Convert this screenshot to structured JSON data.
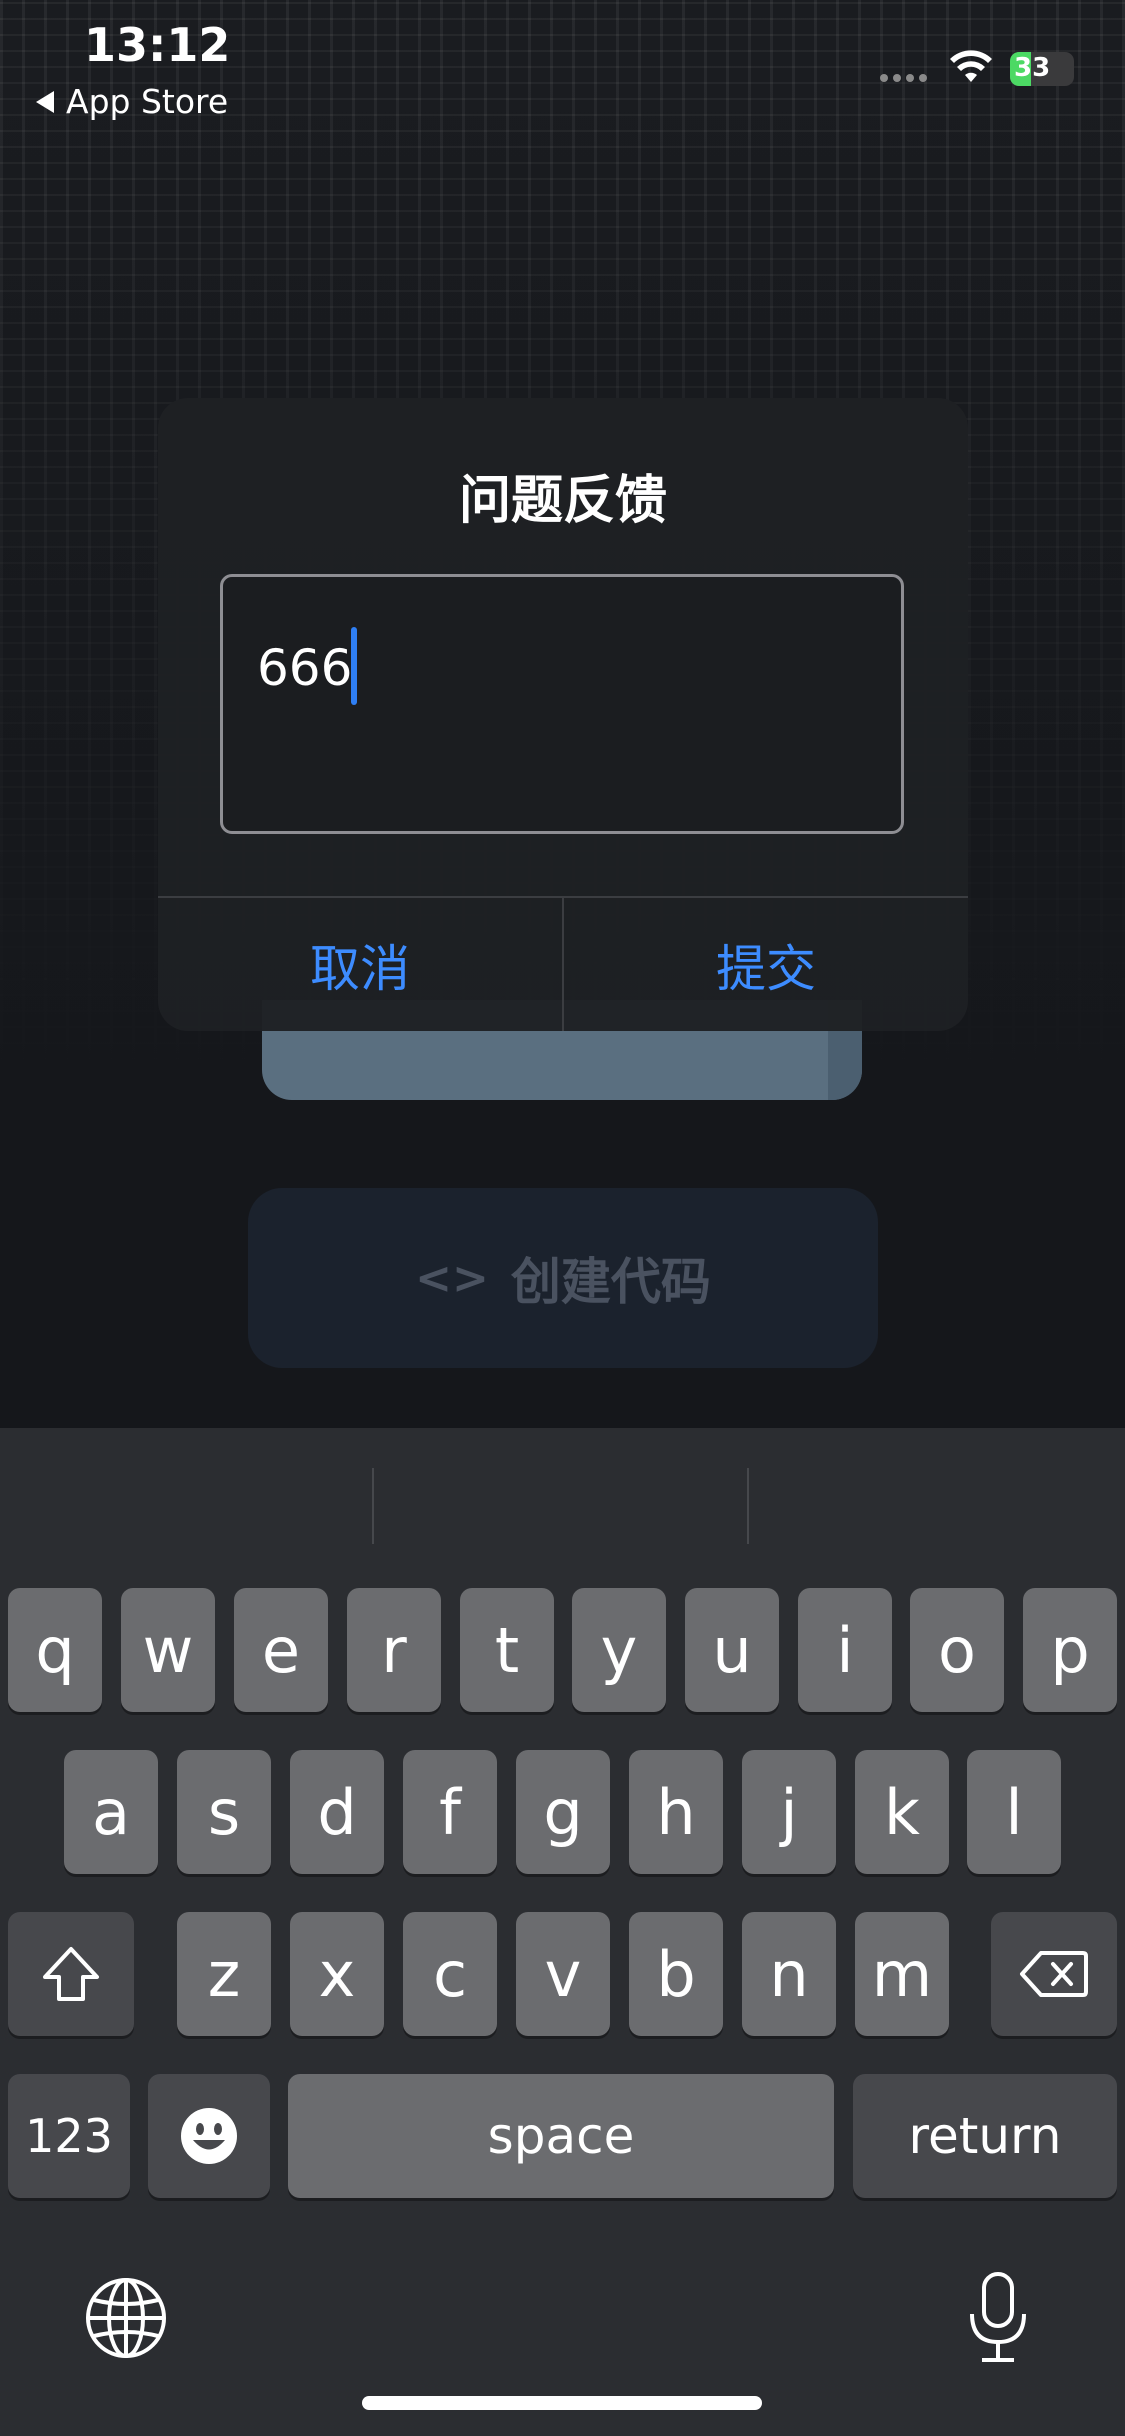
{
  "status_bar": {
    "time": "13:12",
    "back_label": "App Store",
    "battery": "33",
    "battery_level": 0.33,
    "battery_color": "#4cd964"
  },
  "background": {
    "create_button_icon": "<>",
    "create_button_label": "创建代码"
  },
  "dialog": {
    "title": "问题反馈",
    "input_value": "666",
    "cancel_label": "取消",
    "submit_label": "提交",
    "accent_color": "#3d8cff"
  },
  "keyboard": {
    "row1": [
      "q",
      "w",
      "e",
      "r",
      "t",
      "y",
      "u",
      "i",
      "o",
      "p"
    ],
    "row2": [
      "a",
      "s",
      "d",
      "f",
      "g",
      "h",
      "j",
      "k",
      "l"
    ],
    "row3": [
      "z",
      "x",
      "c",
      "v",
      "b",
      "n",
      "m"
    ],
    "numbers_label": "123",
    "space_label": "space",
    "return_label": "return",
    "icons": [
      "shift-icon",
      "backspace-icon",
      "emoji-icon",
      "globe-icon",
      "microphone-icon"
    ]
  }
}
